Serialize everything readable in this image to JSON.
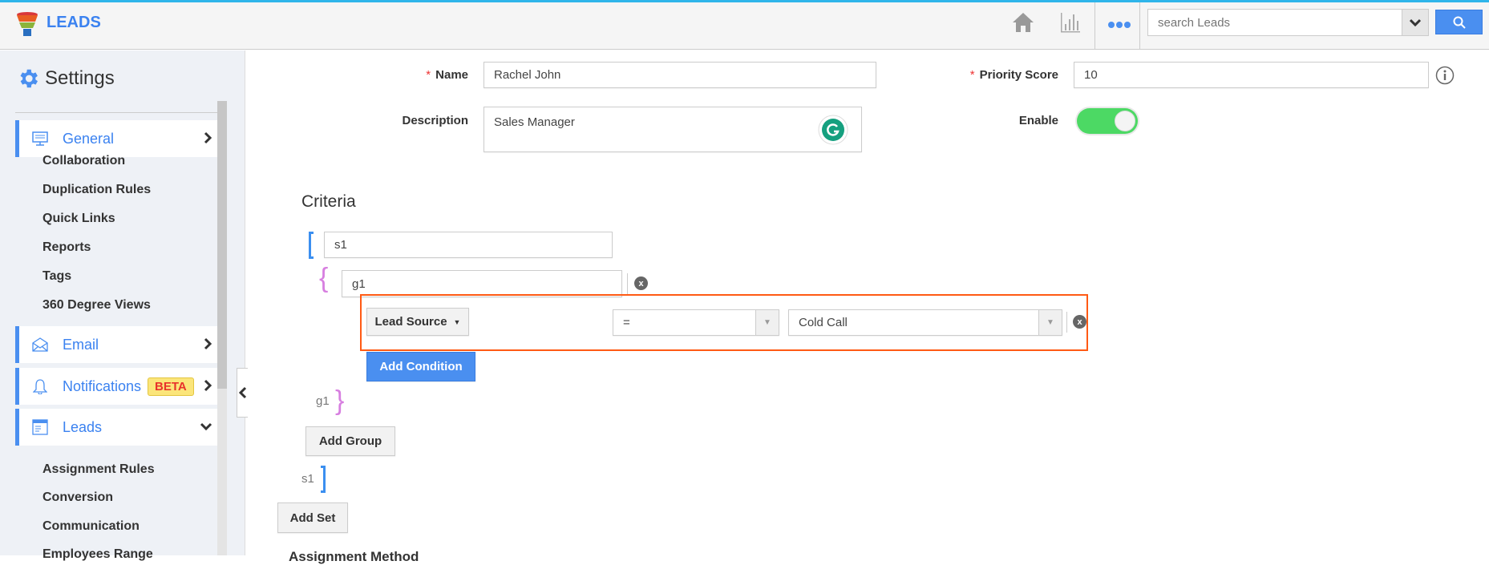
{
  "header": {
    "app_name": "LEADS",
    "search_placeholder": "search Leads",
    "icons": [
      "funnel-logo-icon",
      "home-icon",
      "chart-icon",
      "more-dots-icon",
      "chevron-down-icon",
      "search-icon"
    ],
    "accent": "#4a8ff0"
  },
  "sidebar": {
    "title": "Settings",
    "sections": [
      {
        "label": "General",
        "icon": "monitor-icon",
        "items": [
          "Collaboration",
          "Duplication Rules",
          "Quick Links",
          "Reports",
          "Tags",
          "360 Degree Views"
        ]
      },
      {
        "label": "Email",
        "icon": "envelope-icon"
      },
      {
        "label": "Notifications",
        "icon": "bell-icon",
        "badge": "BETA"
      },
      {
        "label": "Leads",
        "icon": "leads-window-icon",
        "items": [
          "Assignment Rules",
          "Conversion",
          "Communication",
          "Employees Range"
        ]
      }
    ]
  },
  "form": {
    "name_label": "Name",
    "name_value": "Rachel John",
    "description_label": "Description",
    "description_value": "Sales Manager",
    "priority_label": "Priority Score",
    "priority_value": "10",
    "enable_label": "Enable",
    "enabled": true,
    "required_mark": "*"
  },
  "criteria": {
    "title": "Criteria",
    "set_name": "s1",
    "group_name": "g1",
    "condition": {
      "field": "Lead Source",
      "operator": "=",
      "value": "Cold Call"
    },
    "add_condition": "Add Condition",
    "add_group": "Add Group",
    "add_set": "Add Set",
    "highlight_color": "#ff5a14"
  },
  "next_section": "Assignment Method"
}
